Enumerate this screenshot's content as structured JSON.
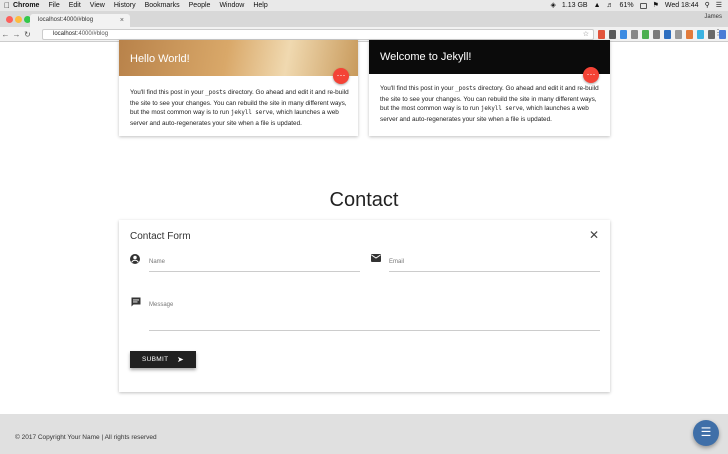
{
  "menubar": {
    "app": "Chrome",
    "items": [
      "File",
      "Edit",
      "View",
      "History",
      "Bookmarks",
      "People",
      "Window",
      "Help"
    ],
    "status": {
      "memory": "1.13 GB",
      "battery": "61%",
      "clock": "Wed 18:44"
    }
  },
  "browser": {
    "tab_title": "localhost:4000/#blog",
    "profile": "James",
    "url_host": "localhost",
    "url_rest": ":4000/#blog"
  },
  "posts": [
    {
      "title": "Hello World!",
      "text_before": "You'll find this post in your ",
      "code1": "_posts",
      "text_middle": " directory. Go ahead and edit it and re-build the site to see your changes. You can rebuild the site in many different ways, but the most common way is to run ",
      "code2": "jekyll serve",
      "text_after": ", which launches a web server and auto-regenerates your site when a file is updated.",
      "more_icon": "more-horizontal-icon"
    },
    {
      "title": "Welcome to Jekyll!",
      "text_before": "You'll find this post in your ",
      "code1": "_posts",
      "text_middle": " directory. Go ahead and edit it and re-build the site to see your changes. You can rebuild the site in many different ways, but the most common way is to run ",
      "code2": "jekyll serve",
      "text_after": ", which launches a web server and auto-regenerates your site when a file is updated.",
      "more_icon": "more-horizontal-icon"
    }
  ],
  "contact": {
    "heading": "Contact",
    "form_title": "Contact Form",
    "name_placeholder": "Name",
    "email_placeholder": "Email",
    "message_placeholder": "Message",
    "submit_label": "SUBMIT"
  },
  "footer": {
    "copyright": "© 2017 Copyright Your Name | All rights reserved"
  },
  "colors": {
    "accent_red": "#f44336",
    "fab_blue": "#3f6fa8",
    "button_dark": "#212121"
  }
}
